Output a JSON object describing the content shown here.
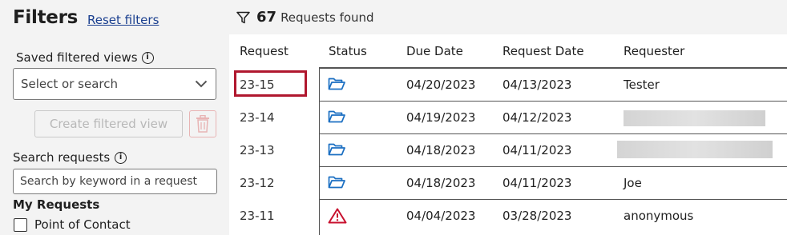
{
  "sidebar": {
    "title": "Filters",
    "reset_label": "Reset filters",
    "saved_views_label": "Saved filtered views",
    "saved_views_placeholder": "Select or search",
    "create_button_label": "Create filtered view",
    "search_label": "Search requests",
    "search_placeholder": "Search by keyword in a request",
    "my_requests_heading": "My Requests",
    "checkbox_label": "Point of Contact"
  },
  "results": {
    "count": "67",
    "label": "Requests found"
  },
  "table": {
    "columns": [
      "Request",
      "Status",
      "Due Date",
      "Request Date",
      "Requester"
    ],
    "rows": [
      {
        "request": "23-15",
        "status_icon": "open-folder-icon",
        "due_date": "04/20/2023",
        "request_date": "04/13/2023",
        "requester": "Tester",
        "redacted": false
      },
      {
        "request": "23-14",
        "status_icon": "open-folder-icon",
        "due_date": "04/19/2023",
        "request_date": "04/12/2023",
        "requester": "",
        "redacted": true
      },
      {
        "request": "23-13",
        "status_icon": "open-folder-icon",
        "due_date": "04/18/2023",
        "request_date": "04/11/2023",
        "requester": "",
        "redacted": true
      },
      {
        "request": "23-12",
        "status_icon": "open-folder-icon",
        "due_date": "04/18/2023",
        "request_date": "04/11/2023",
        "requester": "Joe",
        "redacted": false
      },
      {
        "request": "23-11",
        "status_icon": "warning-triangle-icon",
        "due_date": "04/04/2023",
        "request_date": "03/28/2023",
        "requester": "anonymous",
        "redacted": false
      }
    ]
  },
  "colors": {
    "link": "#1a3f8f",
    "folder": "#1b6fc2",
    "warning": "#c8102e",
    "selection": "#b0172e"
  }
}
